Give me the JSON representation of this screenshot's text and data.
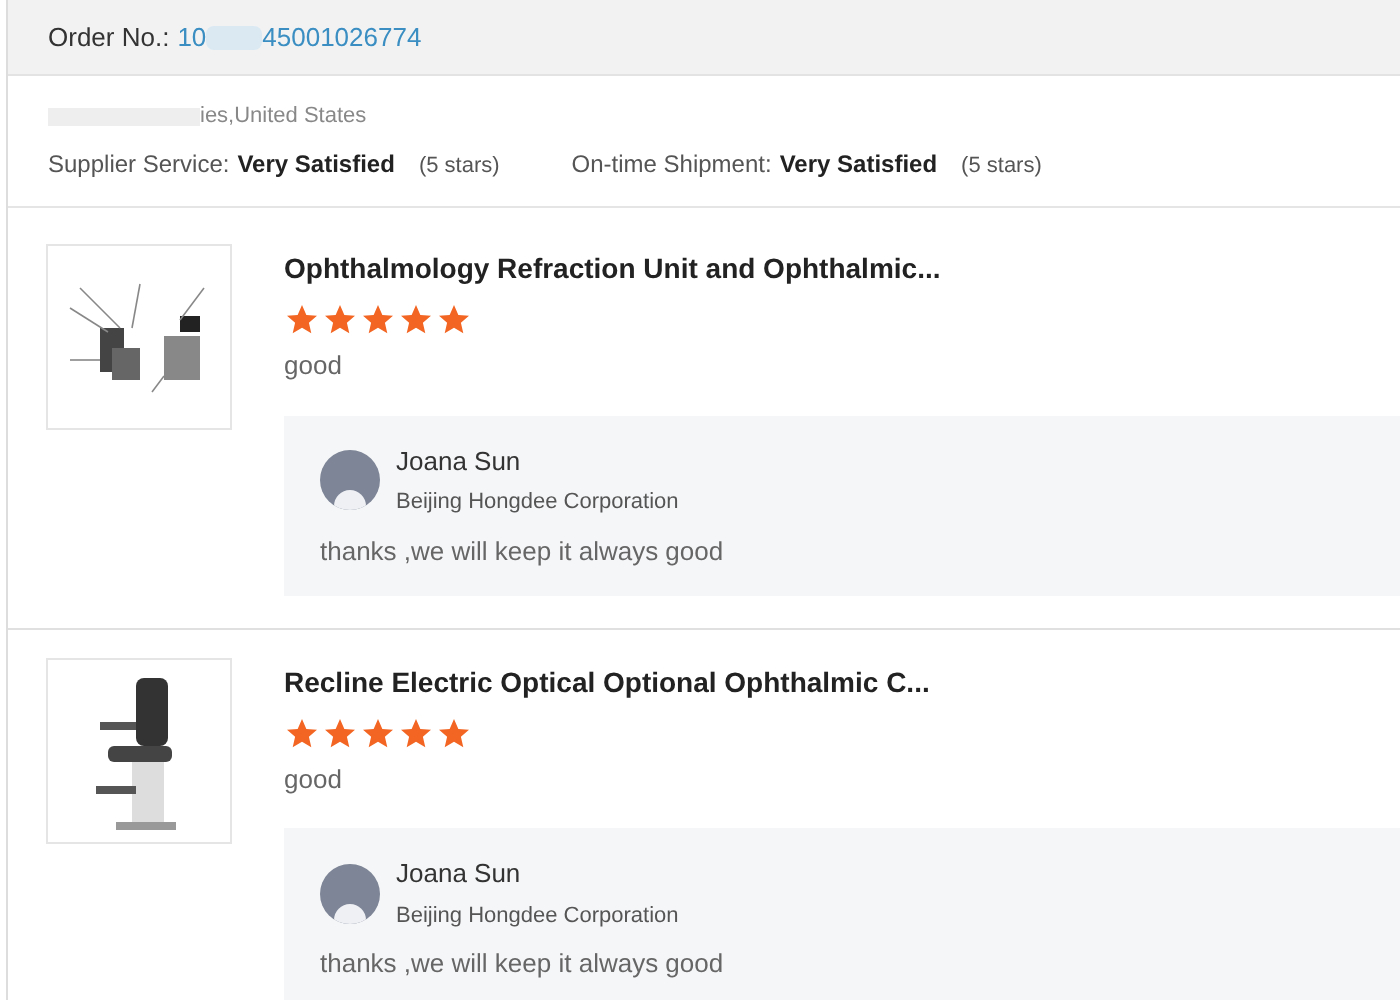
{
  "order": {
    "label": "Order No.:",
    "number_start": "10",
    "number_end": "45001026774"
  },
  "buyer": {
    "location": "ies,United States"
  },
  "ratings": [
    {
      "label": "Supplier Service:",
      "value": "Very Satisfied",
      "stars_text": "(5 stars)"
    },
    {
      "label": "On-time Shipment:",
      "value": "Very Satisfied",
      "stars_text": "(5 stars)"
    }
  ],
  "reviews": [
    {
      "kind": "diagram",
      "title": "Ophthalmology Refraction Unit and Ophthalmic...",
      "stars": 5,
      "comment": "good",
      "reply": {
        "name": "Joana Sun",
        "company": "Beijing Hongdee Corporation",
        "text": "thanks ,we will keep it always good"
      }
    },
    {
      "kind": "chair",
      "title": "Recline Electric Optical Optional Ophthalmic C...",
      "stars": 5,
      "comment": "good",
      "reply": {
        "name": "Joana Sun",
        "company": "Beijing Hongdee Corporation",
        "text": "thanks ,we will keep it always good"
      }
    }
  ]
}
